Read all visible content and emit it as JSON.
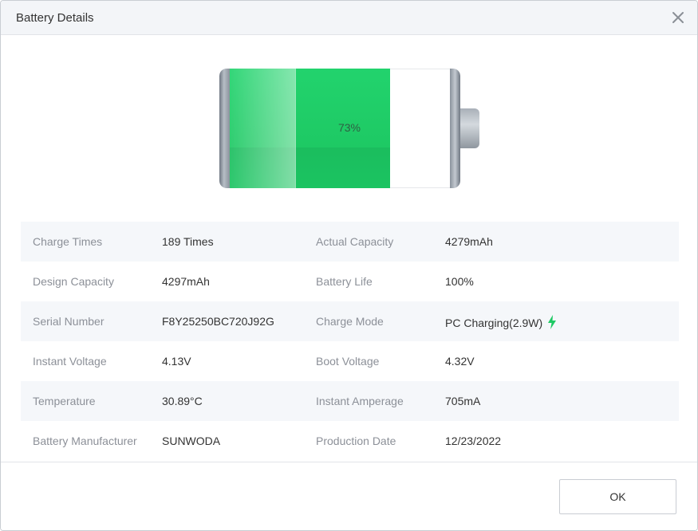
{
  "dialog": {
    "title": "Battery Details",
    "close_icon": "close-icon",
    "ok_label": "OK"
  },
  "battery": {
    "percent_label": "73%",
    "level_percent": 73,
    "accent_color": "#1ec964"
  },
  "details": {
    "rows": [
      {
        "label1": "Charge Times",
        "value1": "189 Times",
        "label2": "Actual Capacity",
        "value2": "4279mAh"
      },
      {
        "label1": "Design Capacity",
        "value1": "4297mAh",
        "label2": "Battery Life",
        "value2": "100%"
      },
      {
        "label1": "Serial Number",
        "value1": "F8Y25250BC720J92G",
        "label2": "Charge Mode",
        "value2": "PC Charging(2.9W)",
        "value2_icon": "lightning-bolt-icon"
      },
      {
        "label1": "Instant Voltage",
        "value1": "4.13V",
        "label2": "Boot Voltage",
        "value2": "4.32V"
      },
      {
        "label1": "Temperature",
        "value1": "30.89°C",
        "label2": "Instant Amperage",
        "value2": "705mA"
      },
      {
        "label1": "Battery Manufacturer",
        "value1": "SUNWODA",
        "label2": "Production Date",
        "value2": "12/23/2022"
      }
    ]
  }
}
